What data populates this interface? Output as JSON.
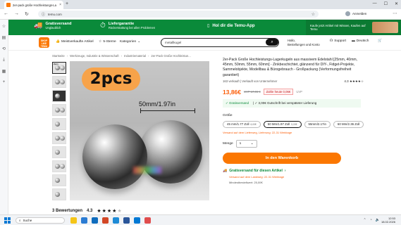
{
  "browser": {
    "tab_title": "2er-pack große Hochleistungs-La",
    "tab_close": "×",
    "new_tab": "+",
    "url": "temu.com",
    "account_label": "Anmelden",
    "win_controls": [
      "—",
      "☐",
      "✕"
    ]
  },
  "promobar": {
    "free_shipping_title": "Gratisversand",
    "free_shipping_sub": "Unglaublich",
    "delivery_title": "Liefergarantie",
    "delivery_sub": "Rückerstattung bei allen Problemen",
    "app_label": "Hol dir die Temu-App",
    "right_text": "Kaufe jetzt Artikel mit Wissen, Kaufen auf Temu"
  },
  "header": {
    "logo_text": "SHOP LIKE TEMU",
    "nav": [
      {
        "label": "Meistverkaufte Artikel"
      },
      {
        "label": "5-Sterne"
      },
      {
        "label": "Kategorien"
      }
    ],
    "search_value": "metallkugel",
    "greeting_line1": "Hallo,",
    "greeting_line2": "Bestellungen und Konto",
    "support_label": "Support",
    "lang_label": "Deutsch"
  },
  "breadcrumb": [
    "Startseite",
    "Werkzeuge, Industrie & Wissenschaft",
    "Industriematerial",
    "2er-Pack Große Hochleistun..."
  ],
  "image": {
    "badge": "2pcs",
    "dimension": "50mm/1.97in"
  },
  "thumbs": [
    {
      "label": "2pcs"
    },
    {
      "label": ""
    },
    {
      "label": ""
    },
    {
      "label": ""
    },
    {
      "label": ""
    },
    {
      "label": ""
    },
    {
      "label": ""
    },
    {
      "label": ""
    },
    {
      "label": ""
    },
    {
      "label": ""
    }
  ],
  "reviews": {
    "count_label": "3 Bewertungen",
    "rating": "4.3",
    "stars": 4.3
  },
  "product": {
    "title": "2er-Pack Große Hochleistungs-Lagerkugeln aus massivem Edelstahl [25mm, 40mm, 45mm, 50mm, 55mm, 60mm] - Zinkbeschichtet, glänzend für DIY-, Fidget-Projekte, Sammelobjekte, Modellbau & Bürogebrauch - Großpackung (Verformungsfreiheit garantiert)",
    "sold_text": "163 verkauft | Verkauft von Unternehmer",
    "rating_text": "4.3 ★★★★☆",
    "price": "13,86€",
    "uvp": "UVP 17,06 €",
    "promo_badge": "Zahle heute 0,06€",
    "uvp_note": "UVP",
    "benefit1": "✓ Gratisversand",
    "benefit2": "| ✓ 3,00€ Gutschrift bei verspäteter Lieferung",
    "size_label": "Größe",
    "sizes": [
      {
        "label": "45 mm/1.77 Zoll",
        "sub": "6,00€"
      },
      {
        "label": "50 Mm/1.97 Zoll",
        "sub": "5,00€"
      },
      {
        "label": "55mm/2.17in",
        "sub": ""
      },
      {
        "label": "60 Mm/2.36 Zoll",
        "sub": ""
      }
    ],
    "size_hint": "Versand auf dem Lieferweg, Lieferung: 22-31 Werktage",
    "qty_label": "Menge",
    "qty_value": "1",
    "cart_label": "In den Warenkorb",
    "ship_title": "Gratisversand für diesen Artikel",
    "ship_sub": "Versand auf dem Landweg: 22-31 Werktage",
    "ship_sub2": "Mindestbestellwert: 25,00€"
  },
  "taskbar": {
    "search_label": "Suche",
    "time": "12:53",
    "date": "18.02.2026"
  },
  "colors": {
    "brand_orange": "#fb7701",
    "promo_green": "#0a8a3a",
    "price_orange": "#fb5c05"
  }
}
